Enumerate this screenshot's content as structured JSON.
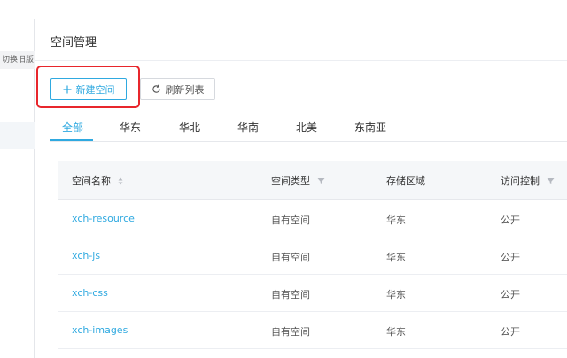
{
  "sidebar": {
    "switch_label": "切换旧版"
  },
  "page": {
    "title": "空间管理"
  },
  "toolbar": {
    "new_label": "新建空间",
    "refresh_label": "刷新列表"
  },
  "tabs": [
    {
      "label": "全部"
    },
    {
      "label": "华东"
    },
    {
      "label": "华北"
    },
    {
      "label": "华南"
    },
    {
      "label": "北美"
    },
    {
      "label": "东南亚"
    }
  ],
  "table": {
    "headers": [
      {
        "label": "空间名称",
        "icon": "sort-icon"
      },
      {
        "label": "空间类型",
        "icon": "filter-icon"
      },
      {
        "label": "存储区域"
      },
      {
        "label": "访问控制",
        "icon": "filter-icon"
      }
    ],
    "rows": [
      {
        "name": "xch-resource",
        "type": "自有空间",
        "region": "华东",
        "access": "公开"
      },
      {
        "name": "xch-js",
        "type": "自有空间",
        "region": "华东",
        "access": "公开"
      },
      {
        "name": "xch-css",
        "type": "自有空间",
        "region": "华东",
        "access": "公开"
      },
      {
        "name": "xch-images",
        "type": "自有空间",
        "region": "华东",
        "access": "公开"
      }
    ]
  },
  "colors": {
    "accent": "#2fa9e0",
    "highlight": "#e8262c"
  }
}
